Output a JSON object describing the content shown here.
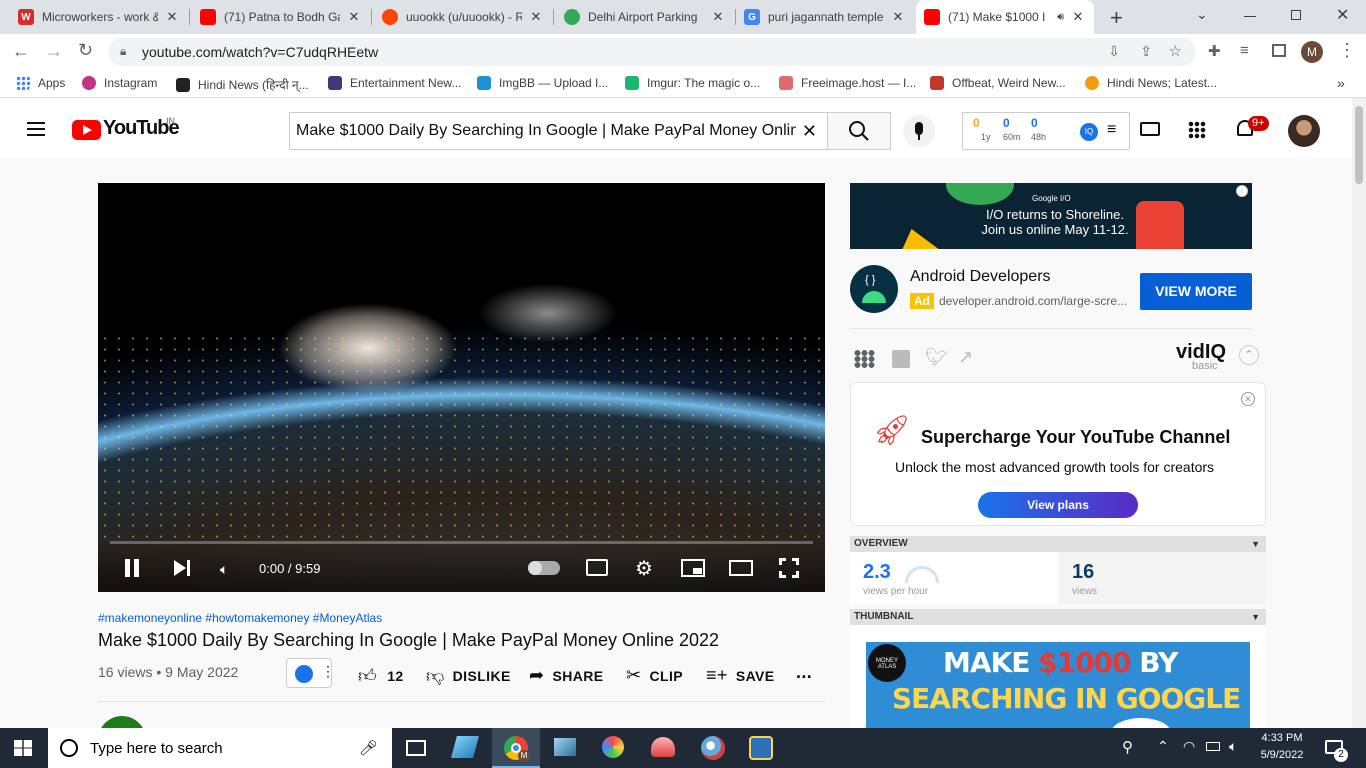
{
  "browser": {
    "tabs": [
      {
        "title": "Microworkers - work &",
        "icon": "W",
        "color": "#d62b2b"
      },
      {
        "title": "(71) Patna to Bodh Ga",
        "icon": "yt",
        "color": "#ff0000"
      },
      {
        "title": "uuookk (u/uuookk) - R",
        "icon": "reddit",
        "color": "#ff4500"
      },
      {
        "title": "Delhi Airport Parking",
        "icon": "maps",
        "color": "#34a853"
      },
      {
        "title": "puri jagannath temple",
        "icon": "G",
        "color": "#4285f4"
      },
      {
        "title": "(71) Make $1000 I",
        "icon": "yt",
        "color": "#ff0000"
      }
    ],
    "close_glyph": "✕",
    "new_tab_glyph": "+",
    "url": "youtube.com/watch?v=C7udqRHEetw",
    "profile_initial": "M",
    "bookmarks": [
      {
        "label": "Apps",
        "color": "#4285f4"
      },
      {
        "label": "Instagram",
        "color": "#c13584"
      },
      {
        "label": "Hindi News (हिन्दी न्...",
        "color": "#222222"
      },
      {
        "label": "Entertainment New...",
        "color": "#3b3b7a"
      },
      {
        "label": "ImgBB — Upload I...",
        "color": "#1d91d2"
      },
      {
        "label": "Imgur: The magic o...",
        "color": "#1bb76e"
      },
      {
        "label": "Freeimage.host — I...",
        "color": "#e06b6b"
      },
      {
        "label": "Offbeat, Weird New...",
        "color": "#c0392b"
      },
      {
        "label": "Hindi News; Latest...",
        "color": "#f39c12"
      }
    ],
    "bookmarks_more": "»"
  },
  "youtube": {
    "logo": "YouTube",
    "country": "IN",
    "search_value": "Make $1000 Daily By Searching In Google | Make PayPal Money Online",
    "vidiq_stats": [
      {
        "value": "0",
        "label": "1y"
      },
      {
        "value": "0",
        "label": "60m"
      },
      {
        "value": "0",
        "label": "48h"
      }
    ],
    "notifications": "9+"
  },
  "video": {
    "time": "0:00 / 9:59",
    "progress_fraction": 0.0,
    "hashtags": "#makemoneyonline #howtomakemoney #MoneyAtlas",
    "title": "Make $1000 Daily By Searching In Google | Make PayPal Money Online 2022",
    "meta": "16 views • 9 May 2022",
    "likes": "12",
    "dislike": "DISLIKE",
    "share": "SHARE",
    "clip": "CLIP",
    "save": "SAVE",
    "more": "..."
  },
  "ad": {
    "brand_top": "Google I/O",
    "line1": "I/O returns to Shoreline.",
    "line2": "Join us online May 11-12.",
    "info": "i",
    "advertiser": "Android Developers",
    "badge": "Ad",
    "url": "developer.android.com/large-scre...",
    "cta": "VIEW MORE"
  },
  "vidiq": {
    "brand": "vidIQ",
    "tier": "basic",
    "promo_title": "Supercharge Your YouTube Channel",
    "promo_sub": "Unlock the most advanced growth tools for creators",
    "promo_btn": "View plans",
    "overview_label": "OVERVIEW",
    "vph_value": "2.3",
    "vph_label": "views per hour",
    "views_value": "16",
    "views_label": "views",
    "thumbnail_label": "THUMBNAIL",
    "thumb_line1_a": "MAKE ",
    "thumb_line1_b": "$1000",
    "thumb_line1_c": " BY",
    "thumb_line2": "SEARCHING IN GOOGLE",
    "thumb_logo": "MONEY ATLAS",
    "section_toggle": "▼"
  },
  "taskbar": {
    "search_placeholder": "Type here to search",
    "time": "4:33 PM",
    "date": "5/9/2022",
    "notif_count": "2",
    "chrome_user": "M"
  }
}
